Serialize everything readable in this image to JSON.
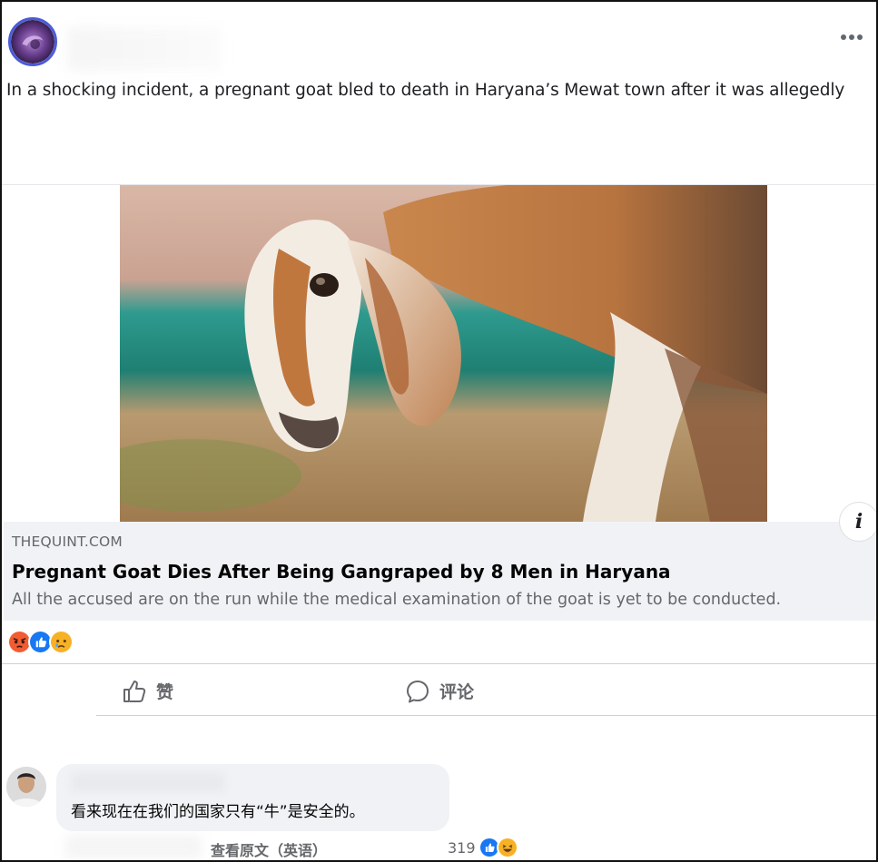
{
  "post": {
    "text": "In a shocking incident, a pregnant goat bled to death in Haryana’s Mewat town after it was allegedly",
    "more_icon": "more-options-icon"
  },
  "link_card": {
    "domain": "THEQUINT.COM",
    "title": "Pregnant Goat Dies After Being Gangraped by 8 Men in Haryana",
    "description": "All the accused are on the run while the medical examination of the goat is yet to be conducted.",
    "info_label": "i"
  },
  "reactions": {
    "icons": [
      "angry-reaction-icon",
      "like-reaction-icon",
      "sad-reaction-icon"
    ]
  },
  "actions": {
    "like_label": "赞",
    "comment_label": "评论"
  },
  "comment": {
    "text": "看来现在在我们的国家只有“牛”是安全的。",
    "see_original": "查看原文（英语）",
    "reaction_count": "319",
    "reaction_icons": [
      "like-reaction-icon",
      "haha-reaction-icon"
    ]
  },
  "colors": {
    "secondary_text": "#65676b",
    "card_bg": "#f0f2f5",
    "like_blue": "#1877f2",
    "angry_orange": "#e9710f",
    "sad_yellow": "#f7b125"
  }
}
